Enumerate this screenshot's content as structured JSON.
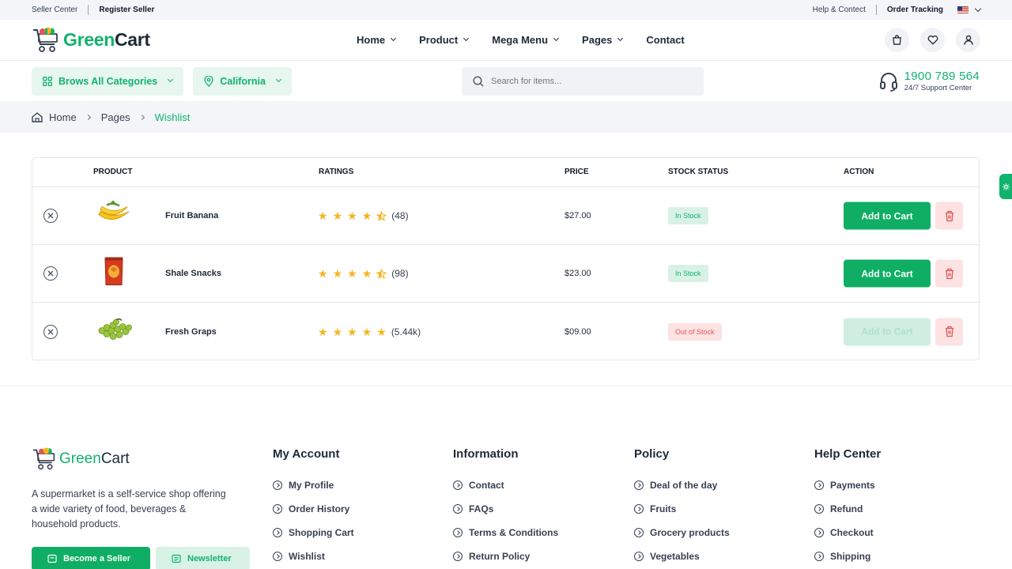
{
  "topbar": {
    "seller_center": "Seller Center",
    "register_seller": "Register Seller",
    "help": "Help & Contect",
    "order_tracking": "Order Tracking"
  },
  "brand": {
    "name_part1": "Green",
    "name_part2": "Cart",
    "accent": "#10b36c"
  },
  "nav": {
    "items": [
      {
        "label": "Home",
        "dropdown": true
      },
      {
        "label": "Product",
        "dropdown": true
      },
      {
        "label": "Mega Menu",
        "dropdown": true
      },
      {
        "label": "Pages",
        "dropdown": true
      },
      {
        "label": "Contact",
        "dropdown": false
      }
    ]
  },
  "subbar": {
    "categories_label": "Brows All Categories",
    "location_label": "California",
    "search_placeholder": "Search for items...",
    "phone": "1900 789 564",
    "support_label": "24/7 Support Center"
  },
  "breadcrumb": {
    "home": "Home",
    "pages": "Pages",
    "current": "Wishlist"
  },
  "table": {
    "headers": {
      "product": "PRODUCT",
      "ratings": "RATINGS",
      "price": "PRICE",
      "stock": "STOCK STATUS",
      "action": "ACTION"
    },
    "rows": [
      {
        "name": "Fruit Banana",
        "rating": 4.5,
        "reviews": "(48)",
        "price": "$27.00",
        "stock": "In Stock",
        "in_stock": true,
        "action": "Add to Cart"
      },
      {
        "name": "Shale Snacks",
        "rating": 4.5,
        "reviews": "(98)",
        "price": "$23.00",
        "stock": "In Stock",
        "in_stock": true,
        "action": "Add to Cart"
      },
      {
        "name": "Fresh Graps",
        "rating": 5,
        "reviews": "(5.44k)",
        "price": "$09.00",
        "stock": "Out of Stock",
        "in_stock": false,
        "action": "Add to Cart"
      }
    ]
  },
  "footer": {
    "description": "A supermarket is a self-service shop offering a wide variety of food, beverages & household products.",
    "become_seller": "Become a Seller",
    "newsletter": "Newsletter",
    "columns": [
      {
        "title": "My Account",
        "links": [
          "My Profile",
          "Order History",
          "Shopping Cart",
          "Wishlist"
        ]
      },
      {
        "title": "Information",
        "links": [
          "Contact",
          "FAQs",
          "Terms & Conditions",
          "Return Policy"
        ]
      },
      {
        "title": "Policy",
        "links": [
          "Deal of the day",
          "Fruits",
          "Grocery products",
          "Vegetables"
        ]
      },
      {
        "title": "Help Center",
        "links": [
          "Payments",
          "Refund",
          "Checkout",
          "Shipping"
        ]
      }
    ]
  }
}
